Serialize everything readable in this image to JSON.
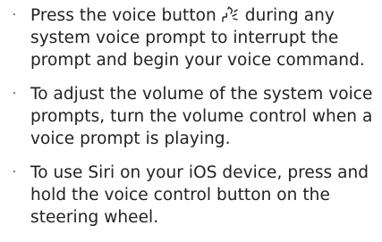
{
  "bullet_symbol": "·",
  "items": [
    {
      "before_icon": "Press the voice button",
      "icon": "voice-command-icon",
      "after_icon": "during any system voice prompt to interrupt the prompt and begin your voice command."
    },
    {
      "text": "To adjust the volume of the system voice prompts, turn the volume control when a voice prompt is playing."
    },
    {
      "text": "To use Siri on your iOS device, press and hold the voice control button on the steering wheel."
    }
  ]
}
